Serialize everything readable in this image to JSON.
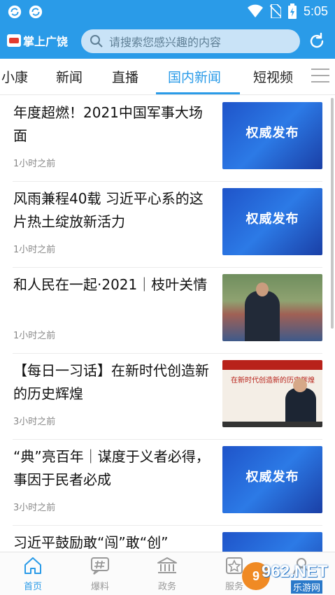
{
  "status_bar": {
    "time": "5:05",
    "left_icons": [
      "sync-icon",
      "sync-icon"
    ],
    "right_icons": [
      "wifi-icon",
      "no-sim-icon",
      "battery-icon"
    ]
  },
  "header": {
    "logo_text": "掌上广饶",
    "search_placeholder": "请搜索您感兴趣的内容",
    "refresh_icon": "refresh-icon"
  },
  "tabs": [
    {
      "label": "小康",
      "active": false
    },
    {
      "label": "新闻",
      "active": false
    },
    {
      "label": "直播",
      "active": false
    },
    {
      "label": "国内新闻",
      "active": true
    },
    {
      "label": "短视频",
      "active": false
    }
  ],
  "feed": [
    {
      "title": "年度超燃！2021中国军事大场面",
      "time": "1小时之前",
      "thumb": "authority",
      "thumb_text": "权威发布"
    },
    {
      "title": "风雨兼程40载 习近平心系的这片热土绽放新活力",
      "time": "1小时之前",
      "thumb": "authority",
      "thumb_text": "权威发布"
    },
    {
      "title": "和人民在一起·2021｜枝叶关情",
      "time": "1小时之前",
      "thumb": "photo-crowd",
      "thumb_text": ""
    },
    {
      "title": "【每日一习话】在新时代创造新的历史辉煌",
      "time": "3小时之前",
      "thumb": "photo-video",
      "thumb_text": "在新时代创造新的历史辉煌"
    },
    {
      "title": "“典”亮百年｜谋度于义者必得，事因于民者必成",
      "time": "3小时之前",
      "thumb": "authority",
      "thumb_text": "权威发布"
    },
    {
      "title": "习近平鼓励敢“闯”敢“创”",
      "time": "",
      "thumb": "authority",
      "thumb_text": ""
    }
  ],
  "bottom_nav": [
    {
      "label": "首页",
      "icon": "home-icon",
      "active": true
    },
    {
      "label": "爆料",
      "icon": "hashtag-chat-icon",
      "active": false
    },
    {
      "label": "政务",
      "icon": "government-building-icon",
      "active": false
    },
    {
      "label": "服务",
      "icon": "star-service-icon",
      "active": false
    },
    {
      "label": "",
      "icon": "user-icon",
      "active": false
    }
  ],
  "watermark": {
    "main": "962.NET",
    "sub": "乐游网",
    "badge": "9"
  },
  "colors": {
    "primary": "#2a9be8",
    "text": "#111111",
    "muted": "#888888"
  }
}
